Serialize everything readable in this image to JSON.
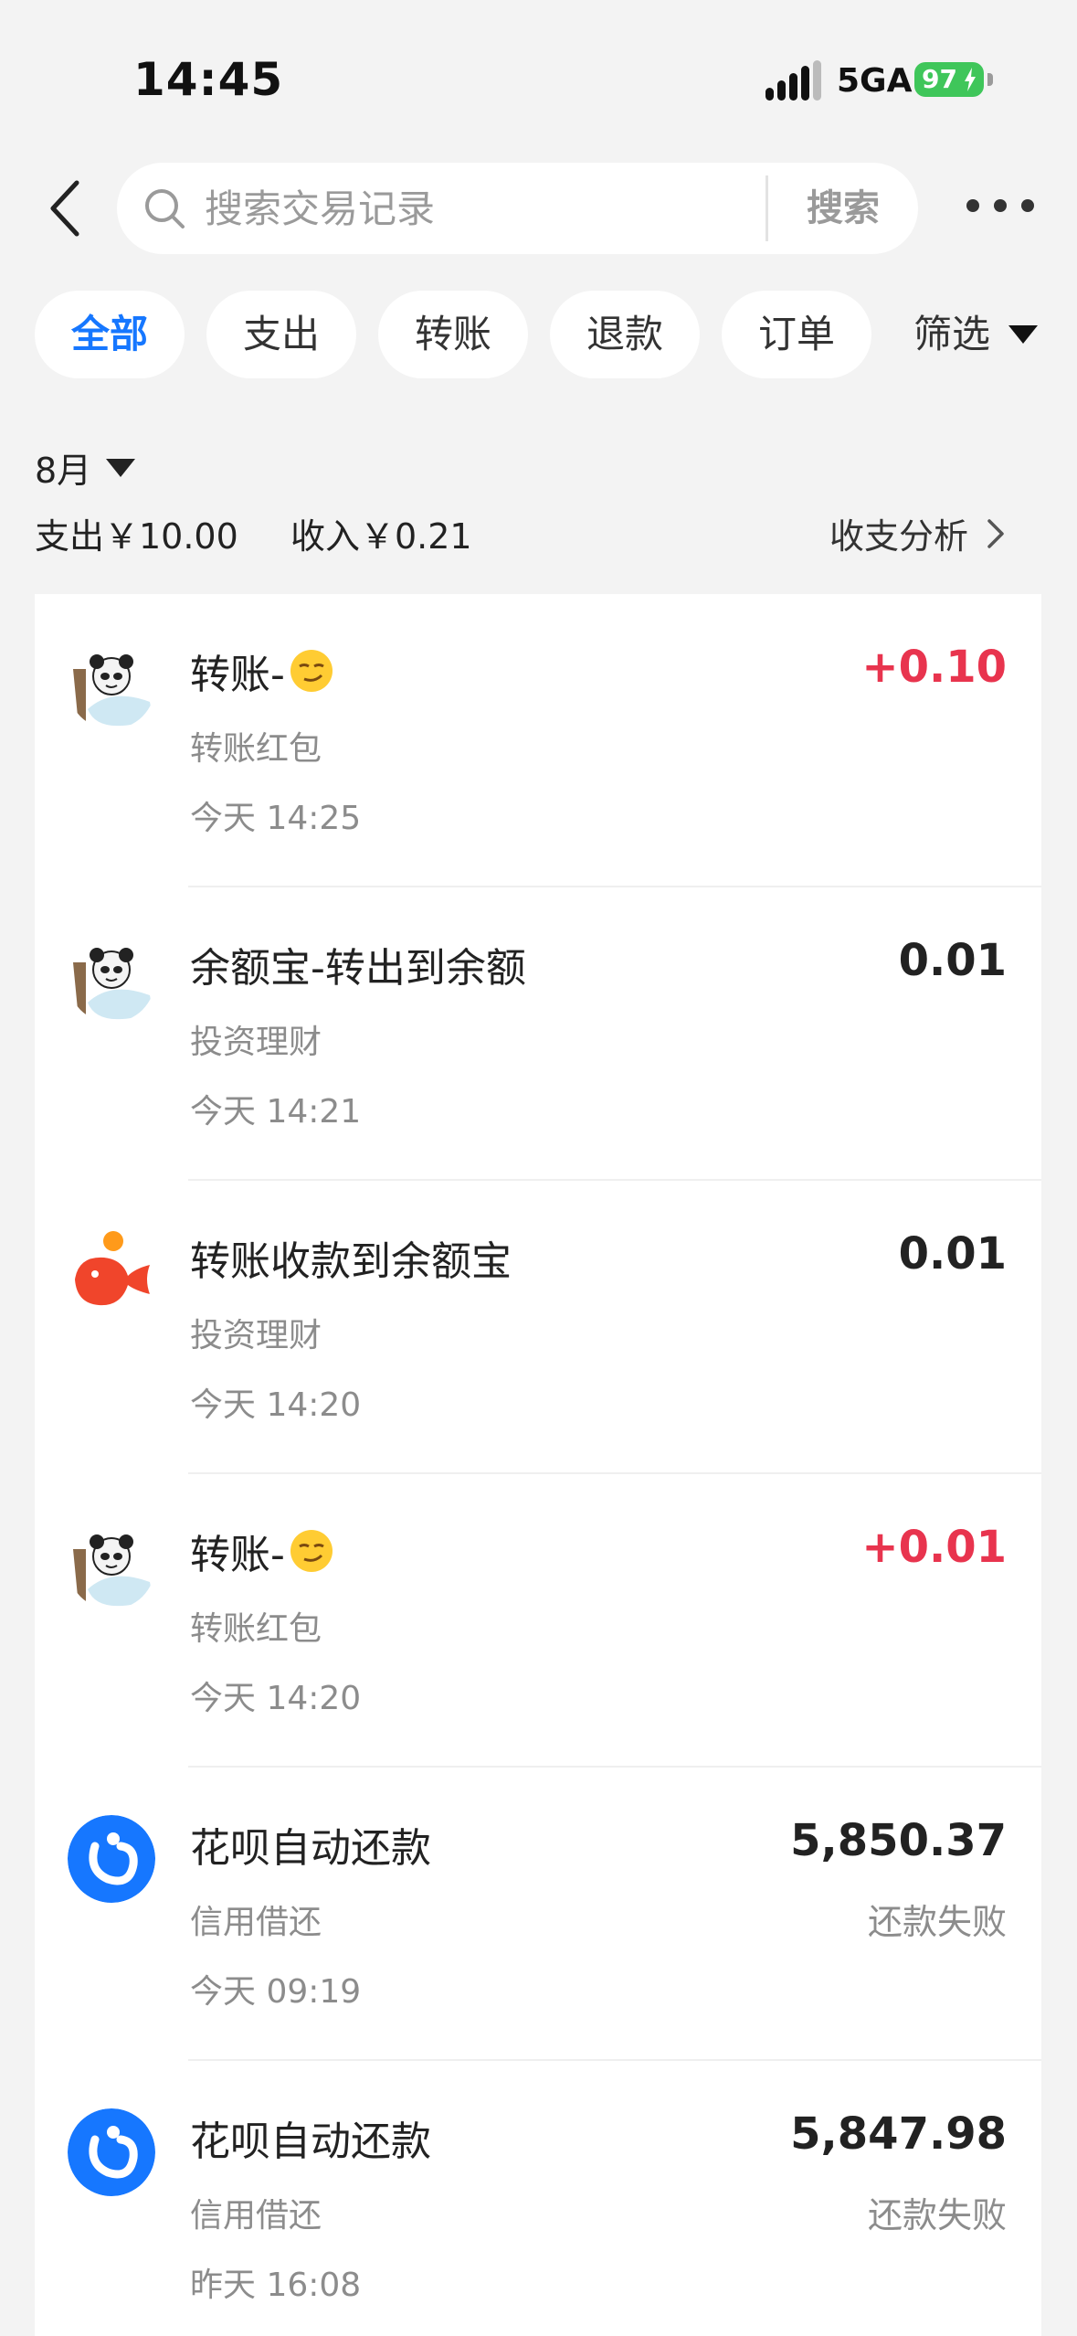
{
  "status_bar": {
    "time": "14:45",
    "network": "5GA",
    "battery": "97"
  },
  "header": {
    "search_placeholder": "搜索交易记录",
    "search_button": "搜索"
  },
  "filters": {
    "chips": [
      {
        "label": "全部",
        "active": true
      },
      {
        "label": "支出",
        "active": false
      },
      {
        "label": "转账",
        "active": false
      },
      {
        "label": "退款",
        "active": false
      },
      {
        "label": "订单",
        "active": false
      }
    ],
    "filter_label": "筛选"
  },
  "summary": {
    "month": "8月",
    "expense": "支出￥10.00",
    "income": "收入￥0.21",
    "analysis": "收支分析"
  },
  "transactions": [
    {
      "title": "转账-",
      "emoji": "smirk-face-icon",
      "category": "转账红包",
      "datetime": "今天 14:25",
      "amount": "+0.10",
      "type": "income",
      "status": "",
      "avatar": "panda-meme-avatar"
    },
    {
      "title": "余额宝-转出到余额",
      "emoji": "",
      "category": "投资理财",
      "datetime": "今天 14:21",
      "amount": "0.01",
      "type": "neutral",
      "status": "",
      "avatar": "panda-meme-avatar"
    },
    {
      "title": "转账收款到余额宝",
      "emoji": "",
      "category": "投资理财",
      "datetime": "今天 14:20",
      "amount": "0.01",
      "type": "neutral",
      "status": "",
      "avatar": "yuebao-logo"
    },
    {
      "title": "转账-",
      "emoji": "smirk-face-icon",
      "category": "转账红包",
      "datetime": "今天 14:20",
      "amount": "+0.01",
      "type": "income",
      "status": "",
      "avatar": "panda-meme-avatar"
    },
    {
      "title": "花呗自动还款",
      "emoji": "",
      "category": "信用借还",
      "datetime": "今天 09:19",
      "amount": "5,850.37",
      "type": "neutral",
      "status": "还款失败",
      "avatar": "huabei-logo"
    },
    {
      "title": "花呗自动还款",
      "emoji": "",
      "category": "信用借还",
      "datetime": "昨天 16:08",
      "amount": "5,847.98",
      "type": "neutral",
      "status": "还款失败",
      "avatar": "huabei-logo"
    }
  ],
  "colors": {
    "accent": "#1677ff",
    "income": "#e8344e",
    "battery": "#3fc65a",
    "background": "#f3f3f3"
  }
}
